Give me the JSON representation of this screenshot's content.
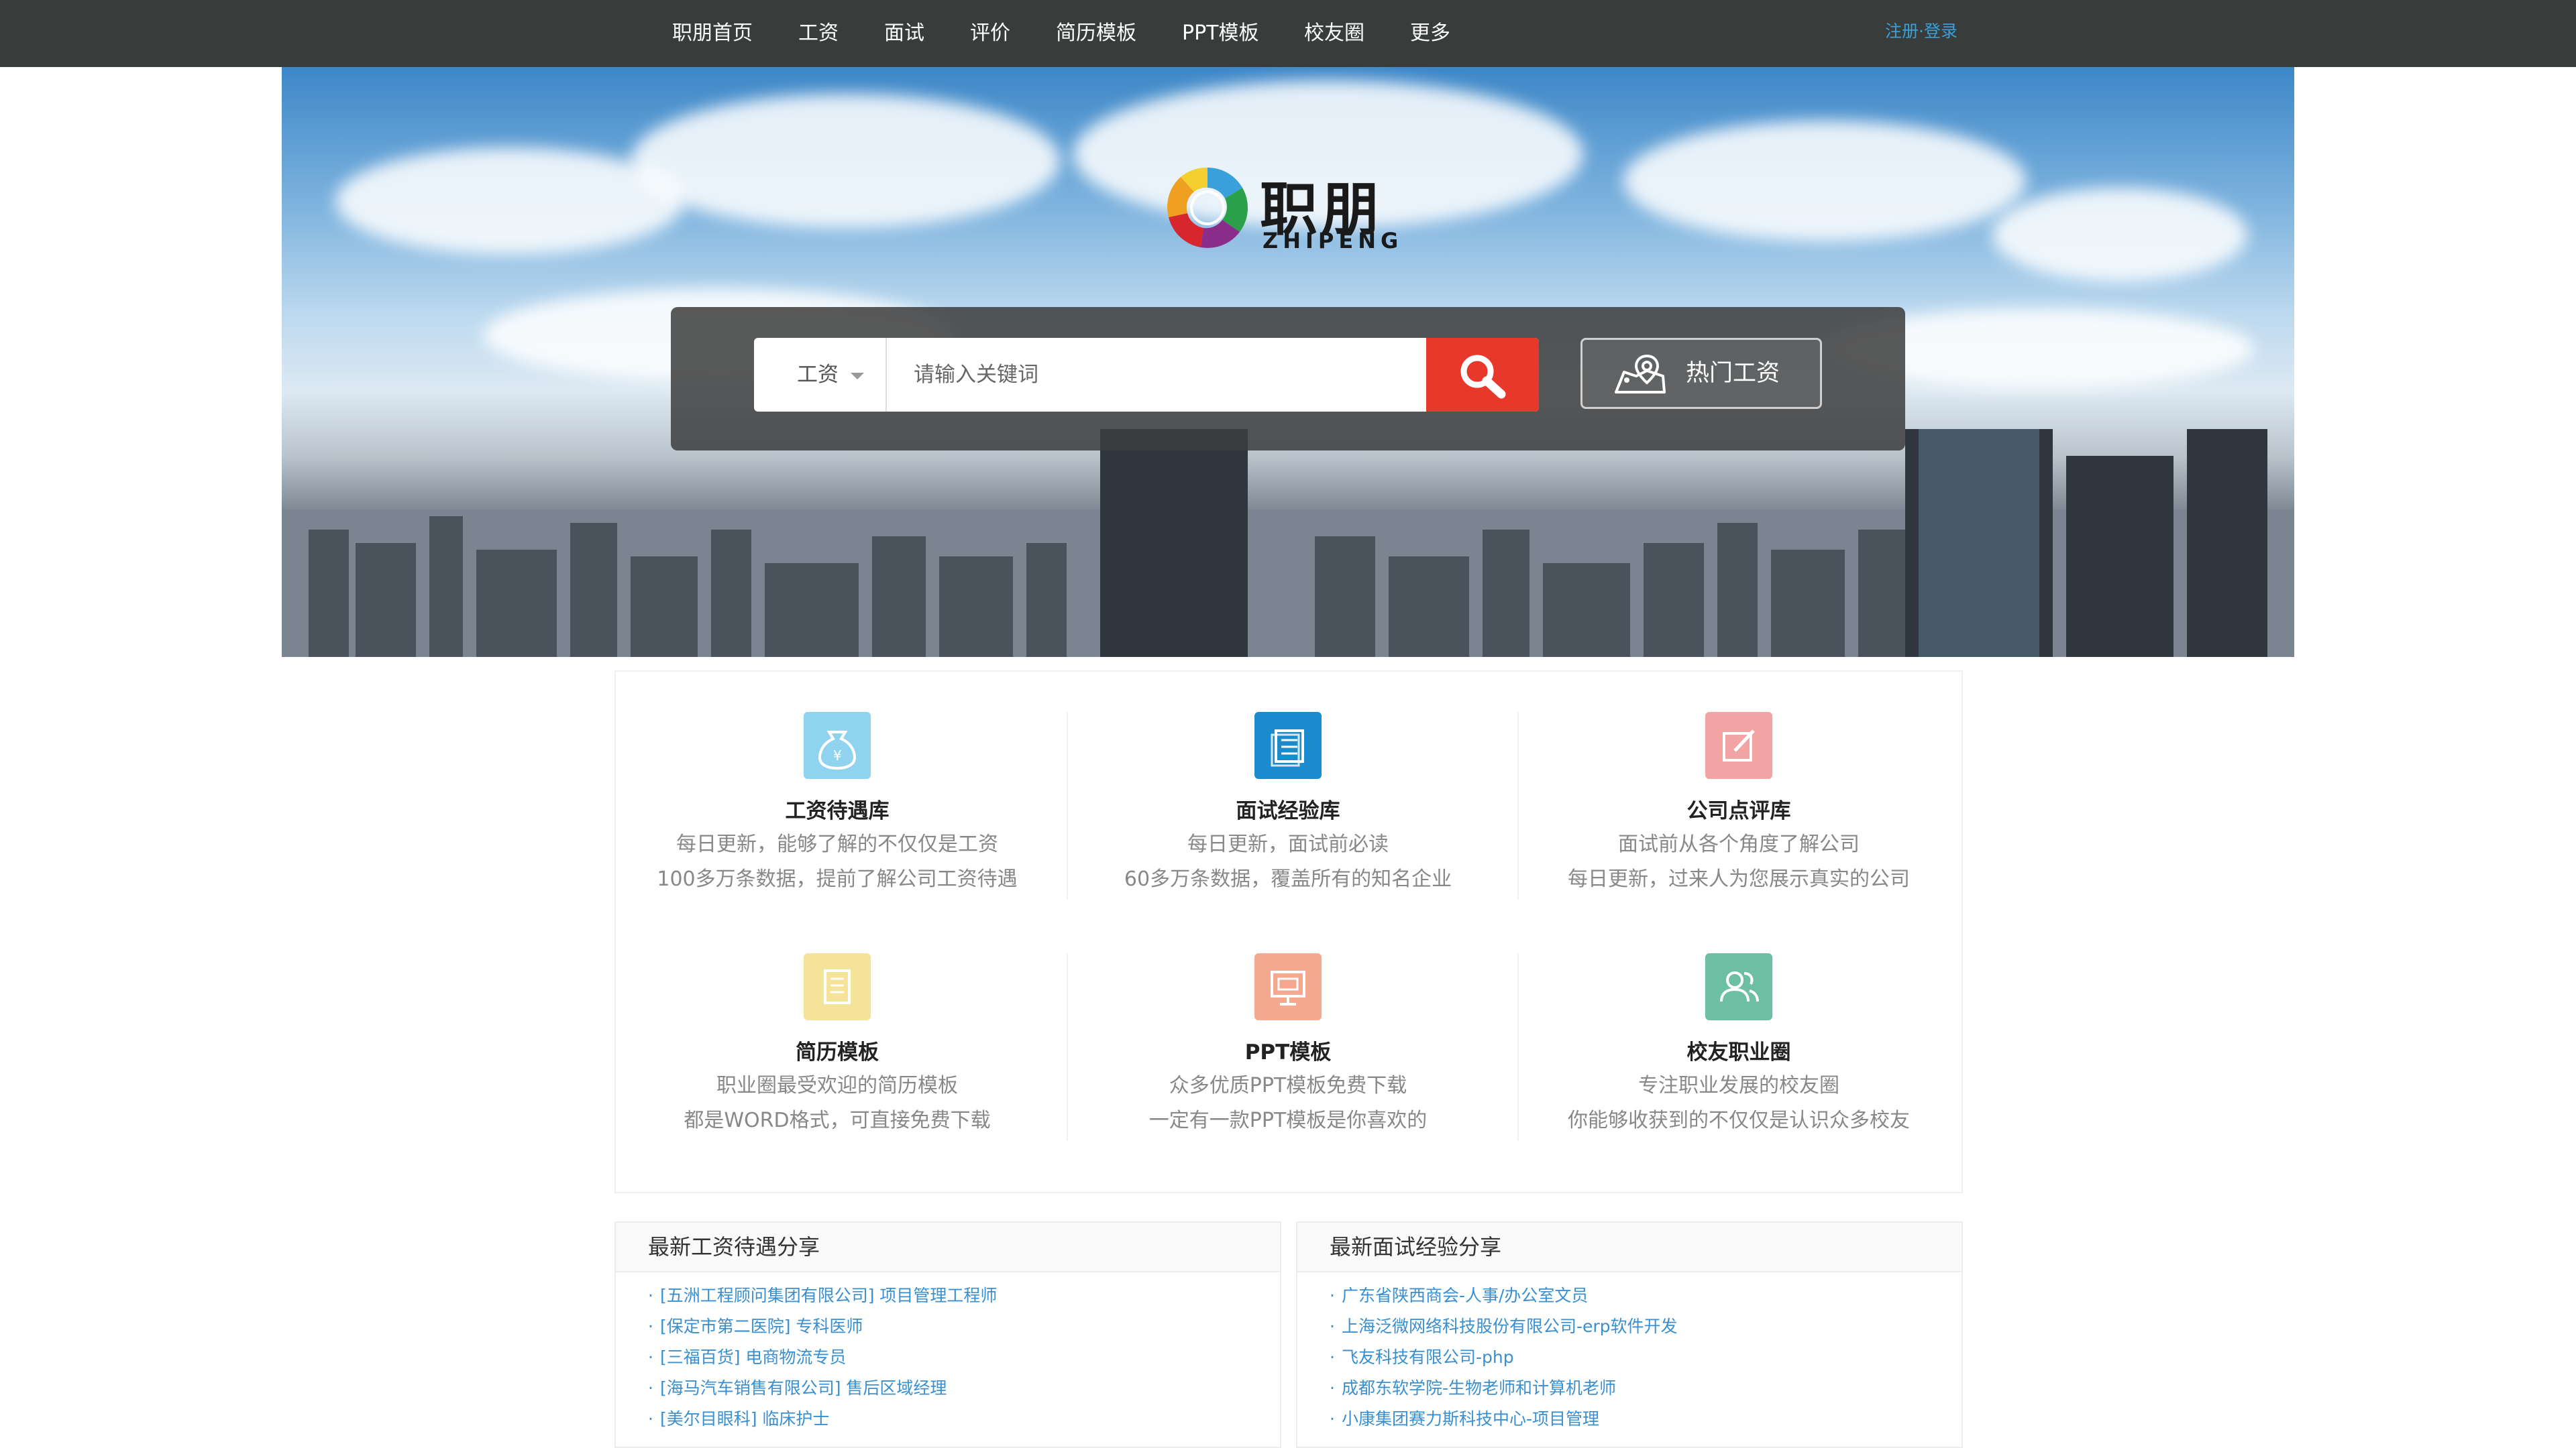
{
  "nav": {
    "items": [
      "职朋首页",
      "工资",
      "面试",
      "评价",
      "简历模板",
      "PPT模板",
      "校友圈",
      "更多"
    ],
    "auth": "注册·登录"
  },
  "hero": {
    "logo_text": "职朋",
    "logo_sub": "ZHIPENG",
    "search": {
      "category": "工资",
      "placeholder": "请输入关键词",
      "hot_label": "热门工资"
    }
  },
  "features": [
    {
      "icon": "money-bag-icon",
      "color": "#8fd3ee",
      "title": "工资待遇库",
      "line1": "每日更新，能够了解的不仅仅是工资",
      "line2": "100多万条数据，提前了解公司工资待遇"
    },
    {
      "icon": "document-stack-icon",
      "color": "#1a8ccd",
      "title": "面试经验库",
      "line1": "每日更新，面试前必读",
      "line2": "60多万条数据，覆盖所有的知名企业"
    },
    {
      "icon": "edit-note-icon",
      "color": "#f2a3a3",
      "title": "公司点评库",
      "line1": "面试前从各个角度了解公司",
      "line2": "每日更新，过来人为您展示真实的公司"
    },
    {
      "icon": "resume-icon",
      "color": "#f5e39a",
      "title": "简历模板",
      "line1": "职业圈最受欢迎的简历模板",
      "line2": "都是WORD格式，可直接免费下载"
    },
    {
      "icon": "presentation-icon",
      "color": "#f4a98f",
      "title": "PPT模板",
      "line1": "众多优质PPT模板免费下载",
      "line2": "一定有一款PPT模板是你喜欢的"
    },
    {
      "icon": "users-icon",
      "color": "#6dbfa4",
      "title": "校友职业圈",
      "line1": "专注职业发展的校友圈",
      "line2": "你能够收获到的不仅仅是认识众多校友"
    }
  ],
  "salary_panel": {
    "title": "最新工资待遇分享",
    "items": [
      "[五洲工程顾问集团有限公司] 项目管理工程师",
      "[保定市第二医院] 专科医师",
      "[三福百货] 电商物流专员",
      "[海马汽车销售有限公司] 售后区域经理",
      "[美尔目眼科] 临床护士"
    ]
  },
  "interview_panel": {
    "title": "最新面试经验分享",
    "items": [
      "广东省陕西商会-人事/办公室文员",
      "上海泛微网络科技股份有限公司-erp软件开发",
      "飞友科技有限公司-php",
      "成都东软学院-生物老师和计算机老师",
      "小康集团赛力斯科技中心-项目管理"
    ]
  },
  "colors": {
    "nav_bg": "#383c3a",
    "accent_red": "#e8382c",
    "link_blue": "#3a8fd0"
  }
}
